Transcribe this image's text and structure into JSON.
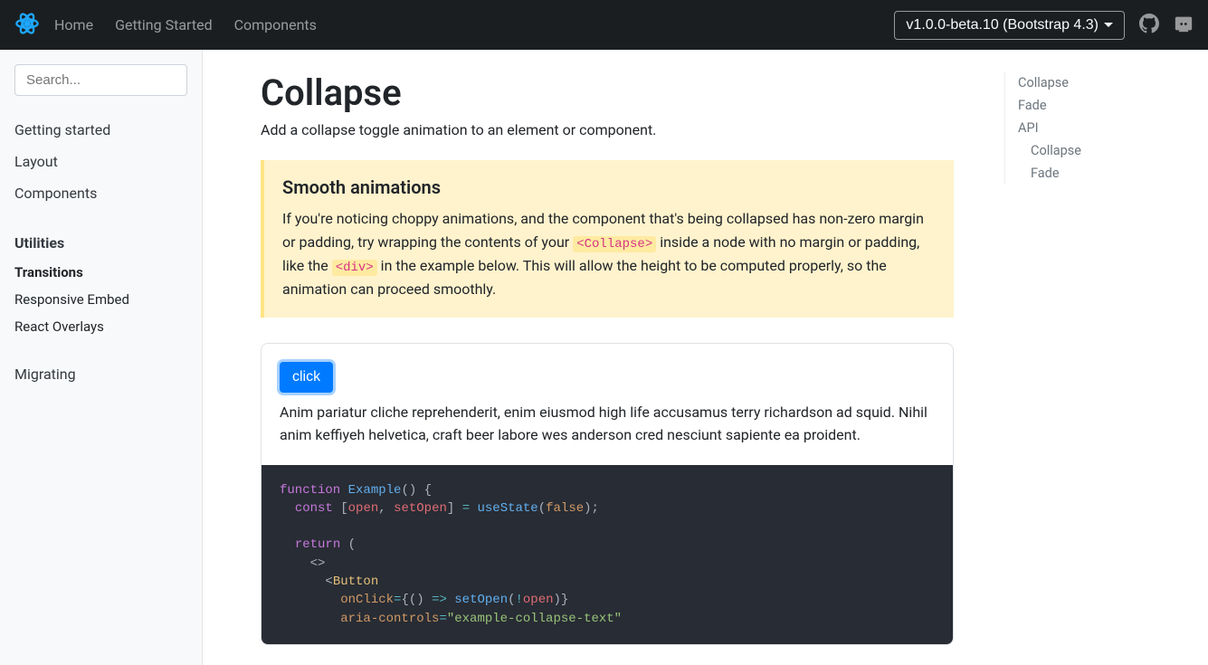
{
  "nav": {
    "links": [
      "Home",
      "Getting Started",
      "Components"
    ],
    "version": "v1.0.0-beta.10 (Bootstrap 4.3)"
  },
  "search": {
    "placeholder": "Search..."
  },
  "sidebar": {
    "top": [
      "Getting started",
      "Layout",
      "Components"
    ],
    "section_title": "Utilities",
    "items": [
      "Transitions",
      "Responsive Embed",
      "React Overlays"
    ],
    "bottom": "Migrating"
  },
  "page": {
    "title": "Collapse",
    "lead": "Add a collapse toggle animation to an element or component."
  },
  "note": {
    "title": "Smooth animations",
    "p1": "If you're noticing choppy animations, and the component that's being collapsed has non-zero margin or padding, try wrapping the contents of your ",
    "code1": "<Collapse>",
    "p2": " inside a node with no margin or padding, like the ",
    "code2": "<div>",
    "p3": " in the example below. This will allow the height to be computed properly, so the animation can proceed smoothly."
  },
  "example": {
    "button": "click",
    "text": "Anim pariatur cliche reprehenderit, enim eiusmod high life accusamus terry richardson ad squid. Nihil anim keffiyeh helvetica, craft beer labore wes anderson cred nesciunt sapiente ea proident."
  },
  "code": {
    "l1_kw": "function",
    "l1_fn": "Example",
    "l1_end": "() {",
    "l2_kw": "const",
    "l2_b1": " [",
    "l2_v1": "open",
    "l2_c": ", ",
    "l2_v2": "setOpen",
    "l2_b2": "] ",
    "l2_op": "=",
    "l2_sp": " ",
    "l2_fn": "useState",
    "l2_p1": "(",
    "l2_bool": "false",
    "l2_p2": ");",
    "l3_kw": "return",
    "l3_end": " (",
    "l4_frag": "<>",
    "l5_lt": "<",
    "l5_tag": "Button",
    "l6_attr": "onClick",
    "l6_eq": "=",
    "l6_b1": "{",
    "l6_p1": "() ",
    "l6_ar": "=>",
    "l6_sp": " ",
    "l6_fn": "setOpen",
    "l6_p2": "(",
    "l6_not": "!",
    "l6_v": "open",
    "l6_p3": ")",
    "l6_b2": "}",
    "l7_attr": "aria-controls",
    "l7_eq": "=",
    "l7_str": "\"example-collapse-text\""
  },
  "toc": {
    "items": [
      "Collapse",
      "Fade",
      "API"
    ],
    "sub": [
      "Collapse",
      "Fade"
    ]
  }
}
